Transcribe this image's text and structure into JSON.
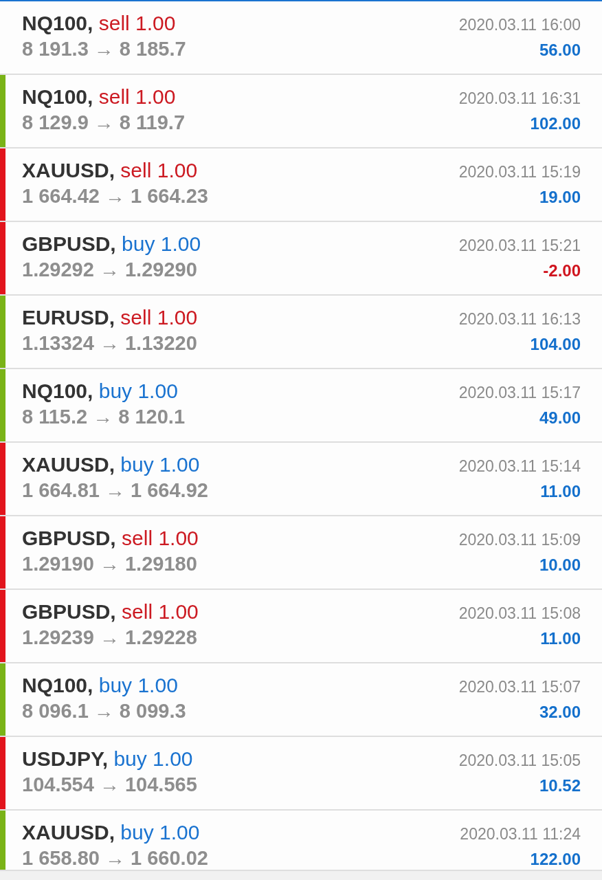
{
  "trades": [
    {
      "symbol": "NQ100,",
      "order": "sell 1.00",
      "kind": "sell",
      "prices": "8 191.3 → 8 185.7",
      "time": "2020.03.11 16:00",
      "profit": "56.00",
      "loss": false
    },
    {
      "symbol": "NQ100,",
      "order": "sell 1.00",
      "kind": "sell",
      "prices": "8 129.9 → 8 119.7",
      "time": "2020.03.11 16:31",
      "profit": "102.00",
      "loss": false,
      "color": "#7ab317"
    },
    {
      "symbol": "XAUUSD,",
      "order": "sell 1.00",
      "kind": "sell",
      "prices": "1 664.42 → 1 664.23",
      "time": "2020.03.11 15:19",
      "profit": "19.00",
      "loss": false,
      "color": "#e2141c"
    },
    {
      "symbol": "GBPUSD,",
      "order": "buy 1.00",
      "kind": "buy",
      "prices": "1.29292 → 1.29290",
      "time": "2020.03.11 15:21",
      "profit": "-2.00",
      "loss": true,
      "color": "#e2141c"
    },
    {
      "symbol": "EURUSD,",
      "order": "sell 1.00",
      "kind": "sell",
      "prices": "1.13324 → 1.13220",
      "time": "2020.03.11 16:13",
      "profit": "104.00",
      "loss": false,
      "color": "#7ab317"
    },
    {
      "symbol": "NQ100,",
      "order": "buy 1.00",
      "kind": "buy",
      "prices": "8 115.2 → 8 120.1",
      "time": "2020.03.11 15:17",
      "profit": "49.00",
      "loss": false,
      "color": "#7ab317"
    },
    {
      "symbol": "XAUUSD,",
      "order": "buy 1.00",
      "kind": "buy",
      "prices": "1 664.81 → 1 664.92",
      "time": "2020.03.11 15:14",
      "profit": "11.00",
      "loss": false,
      "color": "#e2141c"
    },
    {
      "symbol": "GBPUSD,",
      "order": "sell 1.00",
      "kind": "sell",
      "prices": "1.29190 → 1.29180",
      "time": "2020.03.11 15:09",
      "profit": "10.00",
      "loss": false,
      "color": "#e2141c"
    },
    {
      "symbol": "GBPUSD,",
      "order": "sell 1.00",
      "kind": "sell",
      "prices": "1.29239 → 1.29228",
      "time": "2020.03.11 15:08",
      "profit": "11.00",
      "loss": false,
      "color": "#e2141c"
    },
    {
      "symbol": "NQ100,",
      "order": "buy 1.00",
      "kind": "buy",
      "prices": "8 096.1 → 8 099.3",
      "time": "2020.03.11 15:07",
      "profit": "32.00",
      "loss": false,
      "color": "#7ab317"
    },
    {
      "symbol": "USDJPY,",
      "order": "buy 1.00",
      "kind": "buy",
      "prices": "104.554 → 104.565",
      "time": "2020.03.11 15:05",
      "profit": "10.52",
      "loss": false,
      "color": "#e2141c"
    },
    {
      "symbol": "XAUUSD,",
      "order": "buy 1.00",
      "kind": "buy",
      "prices": "1 658.80 → 1 660.02",
      "time": "2020.03.11 11:24",
      "profit": "122.00",
      "loss": false,
      "color": "#7ab317"
    }
  ]
}
